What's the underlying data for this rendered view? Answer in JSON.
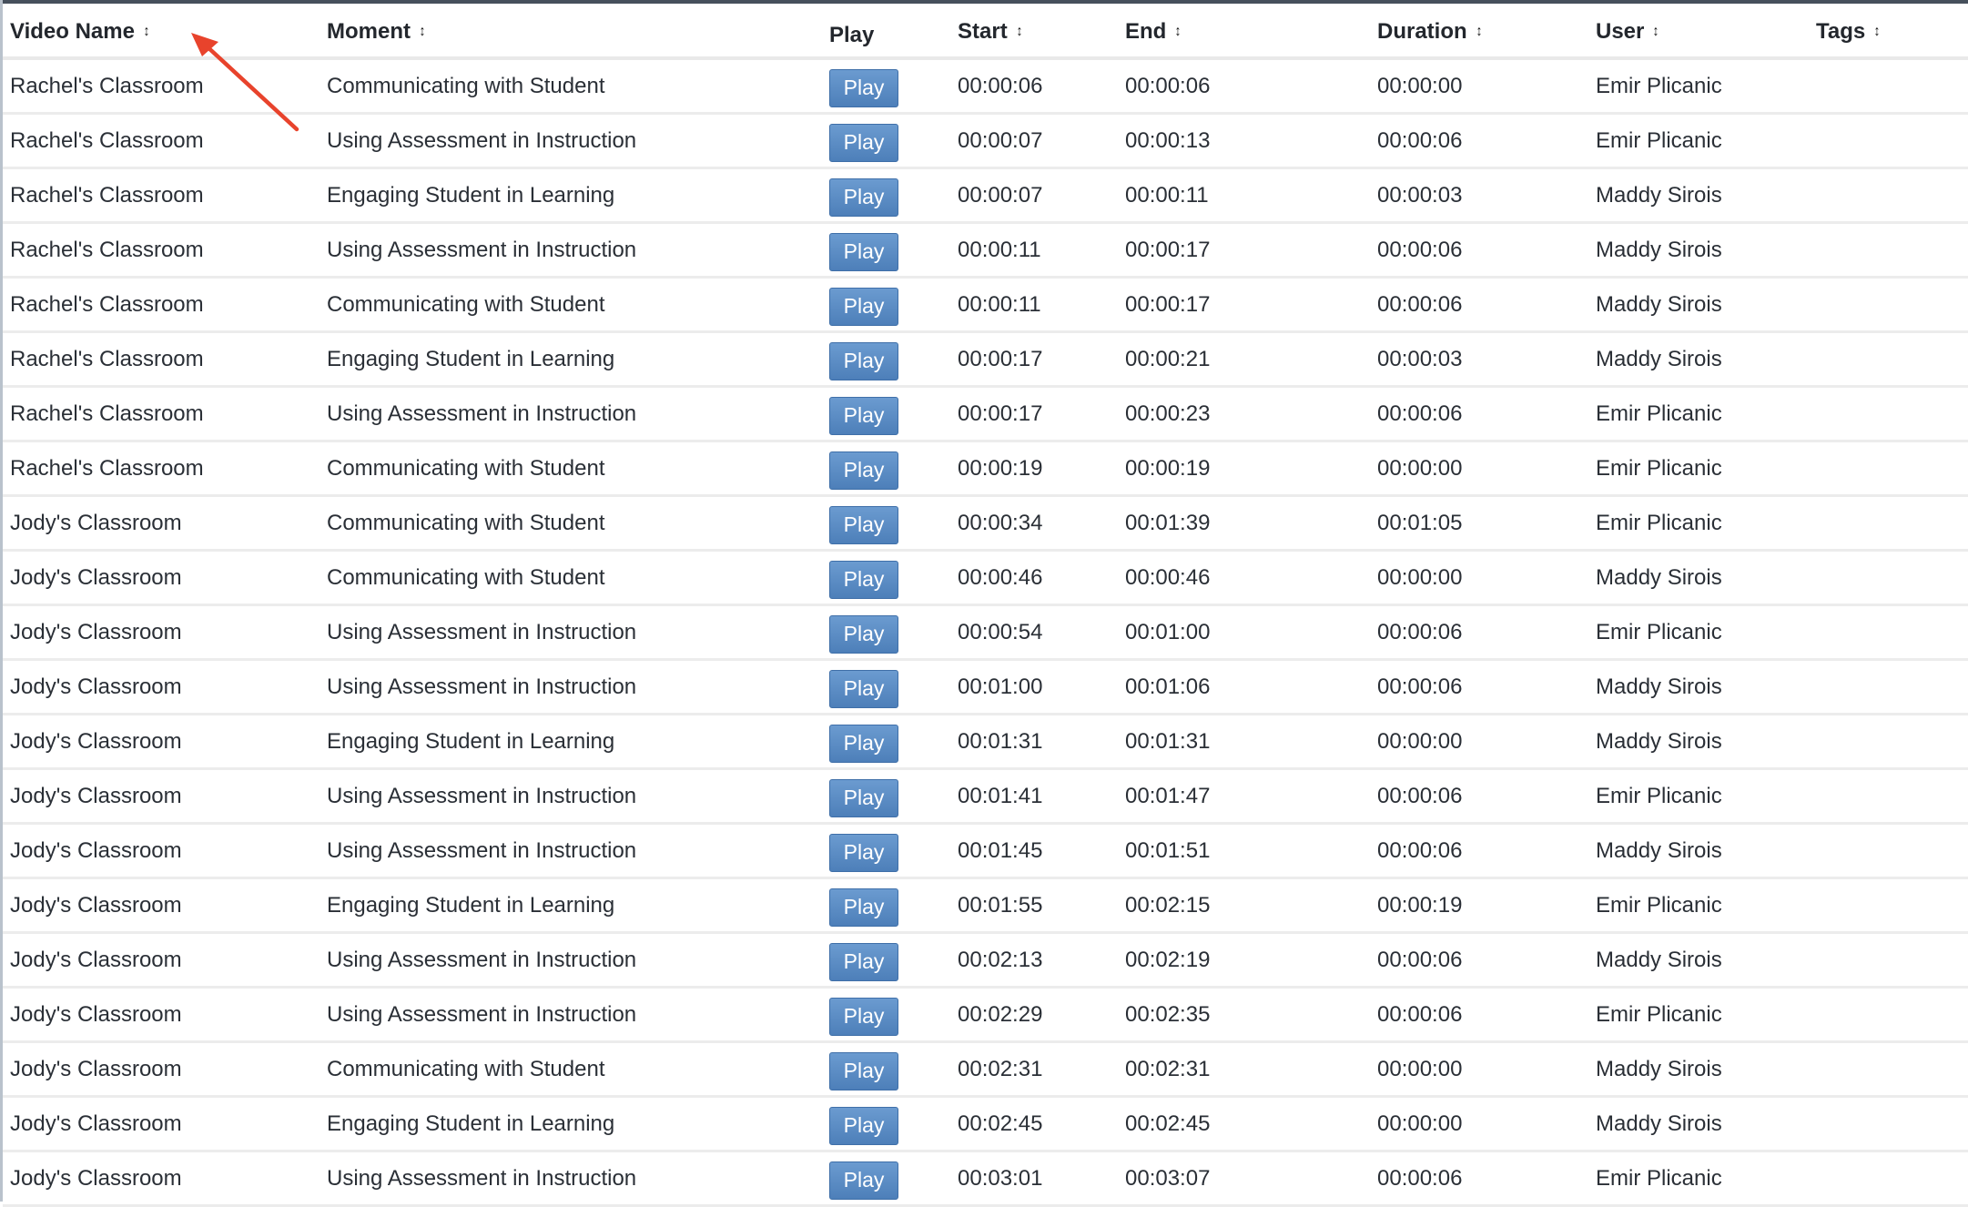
{
  "table": {
    "headers": {
      "video_name": "Video Name",
      "moment": "Moment",
      "play": "Play",
      "start": "Start",
      "end": "End",
      "duration": "Duration",
      "user": "User",
      "tags": "Tags"
    },
    "sort_icon": "↕",
    "play_label": "Play",
    "rows": [
      {
        "video": "Rachel's Classroom",
        "moment": "Communicating with Student",
        "start": "00:00:06",
        "end": "00:00:06",
        "duration": "00:00:00",
        "user": "Emir Plicanic",
        "tags": ""
      },
      {
        "video": "Rachel's Classroom",
        "moment": "Using Assessment in Instruction",
        "start": "00:00:07",
        "end": "00:00:13",
        "duration": "00:00:06",
        "user": "Emir Plicanic",
        "tags": ""
      },
      {
        "video": "Rachel's Classroom",
        "moment": "Engaging Student in Learning",
        "start": "00:00:07",
        "end": "00:00:11",
        "duration": "00:00:03",
        "user": "Maddy Sirois",
        "tags": ""
      },
      {
        "video": "Rachel's Classroom",
        "moment": "Using Assessment in Instruction",
        "start": "00:00:11",
        "end": "00:00:17",
        "duration": "00:00:06",
        "user": "Maddy Sirois",
        "tags": ""
      },
      {
        "video": "Rachel's Classroom",
        "moment": "Communicating with Student",
        "start": "00:00:11",
        "end": "00:00:17",
        "duration": "00:00:06",
        "user": "Maddy Sirois",
        "tags": ""
      },
      {
        "video": "Rachel's Classroom",
        "moment": "Engaging Student in Learning",
        "start": "00:00:17",
        "end": "00:00:21",
        "duration": "00:00:03",
        "user": "Maddy Sirois",
        "tags": ""
      },
      {
        "video": "Rachel's Classroom",
        "moment": "Using Assessment in Instruction",
        "start": "00:00:17",
        "end": "00:00:23",
        "duration": "00:00:06",
        "user": "Emir Plicanic",
        "tags": ""
      },
      {
        "video": "Rachel's Classroom",
        "moment": "Communicating with Student",
        "start": "00:00:19",
        "end": "00:00:19",
        "duration": "00:00:00",
        "user": "Emir Plicanic",
        "tags": ""
      },
      {
        "video": "Jody's Classroom",
        "moment": "Communicating with Student",
        "start": "00:00:34",
        "end": "00:01:39",
        "duration": "00:01:05",
        "user": "Emir Plicanic",
        "tags": ""
      },
      {
        "video": "Jody's Classroom",
        "moment": "Communicating with Student",
        "start": "00:00:46",
        "end": "00:00:46",
        "duration": "00:00:00",
        "user": "Maddy Sirois",
        "tags": ""
      },
      {
        "video": "Jody's Classroom",
        "moment": "Using Assessment in Instruction",
        "start": "00:00:54",
        "end": "00:01:00",
        "duration": "00:00:06",
        "user": "Emir Plicanic",
        "tags": ""
      },
      {
        "video": "Jody's Classroom",
        "moment": "Using Assessment in Instruction",
        "start": "00:01:00",
        "end": "00:01:06",
        "duration": "00:00:06",
        "user": "Maddy Sirois",
        "tags": ""
      },
      {
        "video": "Jody's Classroom",
        "moment": "Engaging Student in Learning",
        "start": "00:01:31",
        "end": "00:01:31",
        "duration": "00:00:00",
        "user": "Maddy Sirois",
        "tags": ""
      },
      {
        "video": "Jody's Classroom",
        "moment": "Using Assessment in Instruction",
        "start": "00:01:41",
        "end": "00:01:47",
        "duration": "00:00:06",
        "user": "Emir Plicanic",
        "tags": ""
      },
      {
        "video": "Jody's Classroom",
        "moment": "Using Assessment in Instruction",
        "start": "00:01:45",
        "end": "00:01:51",
        "duration": "00:00:06",
        "user": "Maddy Sirois",
        "tags": ""
      },
      {
        "video": "Jody's Classroom",
        "moment": "Engaging Student in Learning",
        "start": "00:01:55",
        "end": "00:02:15",
        "duration": "00:00:19",
        "user": "Emir Plicanic",
        "tags": ""
      },
      {
        "video": "Jody's Classroom",
        "moment": "Using Assessment in Instruction",
        "start": "00:02:13",
        "end": "00:02:19",
        "duration": "00:00:06",
        "user": "Maddy Sirois",
        "tags": ""
      },
      {
        "video": "Jody's Classroom",
        "moment": "Using Assessment in Instruction",
        "start": "00:02:29",
        "end": "00:02:35",
        "duration": "00:00:06",
        "user": "Emir Plicanic",
        "tags": ""
      },
      {
        "video": "Jody's Classroom",
        "moment": "Communicating with Student",
        "start": "00:02:31",
        "end": "00:02:31",
        "duration": "00:00:00",
        "user": "Maddy Sirois",
        "tags": ""
      },
      {
        "video": "Jody's Classroom",
        "moment": "Engaging Student in Learning",
        "start": "00:02:45",
        "end": "00:02:45",
        "duration": "00:00:00",
        "user": "Maddy Sirois",
        "tags": ""
      },
      {
        "video": "Jody's Classroom",
        "moment": "Using Assessment in Instruction",
        "start": "00:03:01",
        "end": "00:03:07",
        "duration": "00:00:06",
        "user": "Emir Plicanic",
        "tags": ""
      }
    ]
  },
  "annotation": {
    "type": "arrow",
    "color": "#e8432c",
    "points_to": "Video Name sort icon"
  },
  "colors": {
    "play_button": "#5a8bc6",
    "top_bar": "#46505c"
  }
}
